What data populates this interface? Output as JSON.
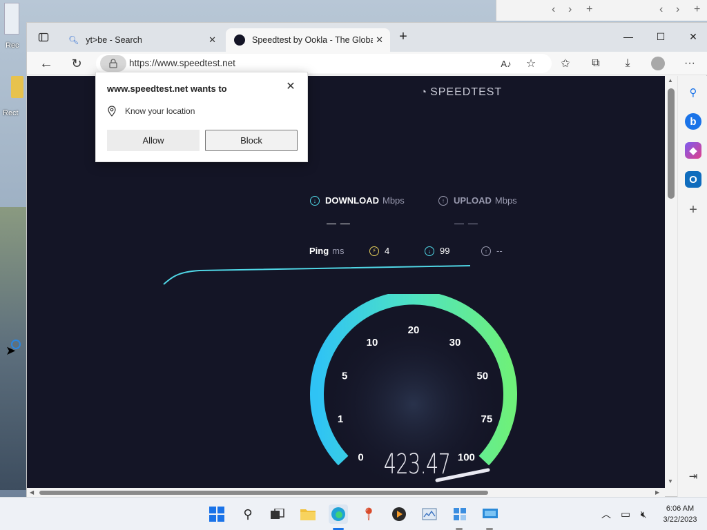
{
  "desktop": {
    "icon_labels": [
      "Rec",
      "Rect"
    ]
  },
  "browser": {
    "tabs": [
      {
        "label": "yt>be - Search",
        "active": false
      },
      {
        "label": "Speedtest by Ookla - The Global",
        "active": true
      }
    ],
    "address": {
      "url": "https://www.speedtest.net"
    }
  },
  "permission_popup": {
    "title": "www.speedtest.net wants to",
    "permission": "Know your location",
    "allow_label": "Allow",
    "block_label": "Block"
  },
  "speedtest": {
    "logo_text": "SPEEDTEST",
    "download_label": "DOWNLOAD",
    "download_unit": "Mbps",
    "download_value": "— —",
    "upload_label": "UPLOAD",
    "upload_unit": "Mbps",
    "upload_value": "— —",
    "ping_label": "Ping",
    "ping_unit": "ms",
    "ping_idle": "4",
    "ping_download": "99",
    "ping_upload": "--",
    "gauge_ticks": [
      "0",
      "1",
      "5",
      "10",
      "20",
      "30",
      "50",
      "75",
      "100"
    ],
    "current_speed": "423.47",
    "colors": {
      "page_bg": "#141526",
      "gauge_start": "#2fc3f5",
      "gauge_end": "#6ef07a",
      "download_accent": "#50d7e6",
      "upload_accent": "#9a9bb0",
      "idle_ping": "#e8d05a"
    }
  },
  "taskbar": {
    "clock_time": "6:06 AM",
    "clock_date": "3/22/2023"
  }
}
